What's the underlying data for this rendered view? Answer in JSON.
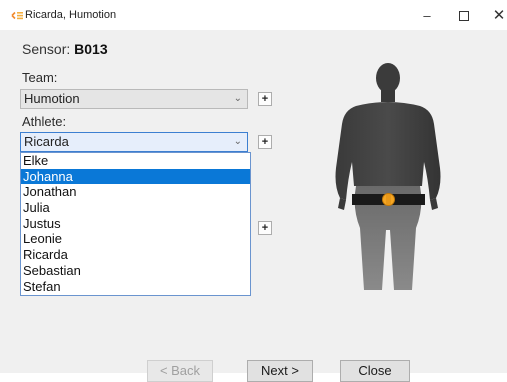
{
  "window": {
    "title": "Ricarda, Humotion",
    "minimize_glyph": "–",
    "close_glyph": "✕"
  },
  "sensor": {
    "label": "Sensor:",
    "value": "B013"
  },
  "team": {
    "label": "Team:",
    "selected": "Humotion",
    "add_label": "+"
  },
  "athlete": {
    "label": "Athlete:",
    "selected": "Ricarda",
    "add_label": "+",
    "options": [
      "Elke",
      "Johanna",
      "Jonathan",
      "Julia",
      "Justus",
      "Leonie",
      "Ricarda",
      "Sebastian",
      "Stefan"
    ],
    "highlighted": "Johanna"
  },
  "extra_add_label": "+",
  "buttons": {
    "back": "< Back",
    "next": "Next >",
    "close": "Close"
  },
  "colors": {
    "highlight": "#0a78d7",
    "belt": "#1a1a1a",
    "sensor_marker": "#f5a623"
  }
}
